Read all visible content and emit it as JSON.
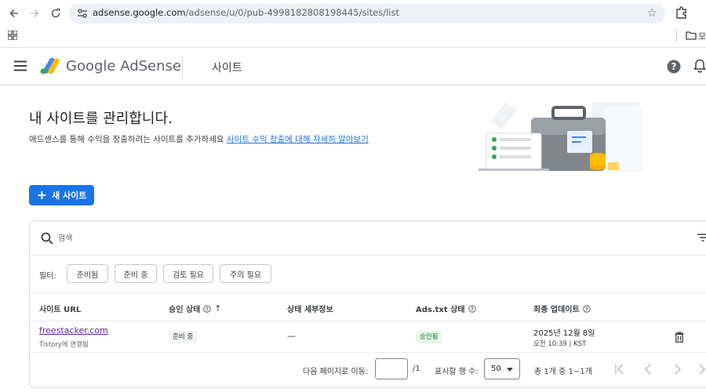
{
  "browser": {
    "url_host": "adsense.google.com",
    "url_path": "/adsense/u/0/pub-4998182808198445/sites/list",
    "bookmark_folder_label": "모"
  },
  "header": {
    "brand": "Google AdSense",
    "section": "사이트"
  },
  "hero": {
    "title": "내 사이트를 관리합니다.",
    "description": "애드센스를 통해 수익을 창출하려는 사이트를 추가하세요",
    "learn_more_link": "사이트 수익 창출에 대해 자세히 알아보기"
  },
  "new_site_button": "새 사이트",
  "search": {
    "placeholder": "검색"
  },
  "filters": {
    "label": "필터:",
    "chips": [
      "준비됨",
      "준비 중",
      "검토 필요",
      "주의 필요"
    ]
  },
  "table": {
    "columns": [
      "사이트 URL",
      "승인 상태",
      "상태 세부정보",
      "Ads.txt 상태",
      "최종 업데이트"
    ],
    "rows": [
      {
        "site_url": "freestacker.com",
        "site_sub": "Tistory에 연결됨",
        "approval_status": "준비 중",
        "status_detail": "—",
        "ads_txt_status": "승인됨",
        "updated_date": "2025년 12월 8일",
        "updated_time": "오전 10:39 | KST"
      }
    ]
  },
  "pagination": {
    "goto_label": "다음 페이지로 이동:",
    "page_total": "/1",
    "rows_label": "표시할 행 수:",
    "rows_value": "50",
    "range_text": "총 1개 중 1~1개"
  },
  "colors": {
    "primary": "#1a73e8",
    "visited_link": "#681da8",
    "success_bg": "#e6f4ea",
    "success_text": "#137333"
  }
}
